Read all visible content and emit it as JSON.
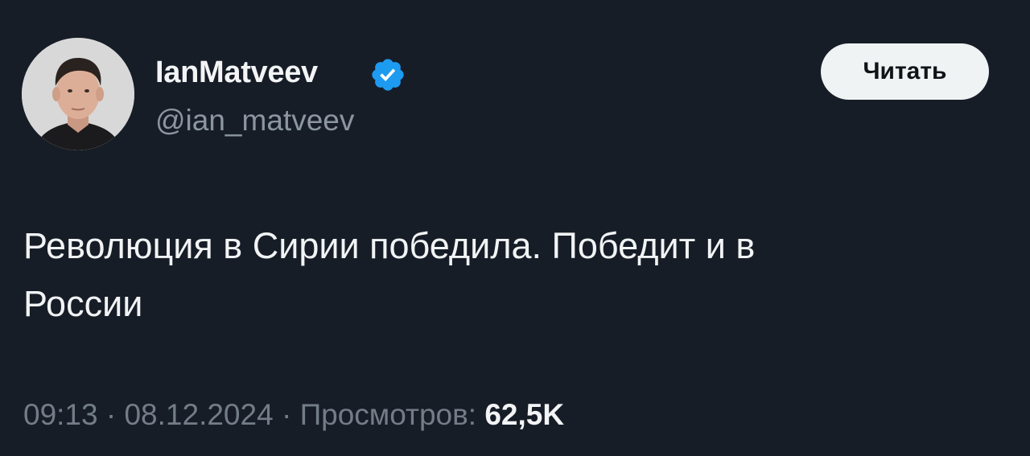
{
  "author": {
    "display_name": "IanMatveev",
    "handle": "@ian_matveev",
    "verified": true
  },
  "follow_button": {
    "label": "Читать"
  },
  "tweet": {
    "text": "Революция в Сирии победила. Победит и в\nРоссии"
  },
  "meta": {
    "time": "09:13",
    "separator": " · ",
    "date": "08.12.2024",
    "views_label": "Просмотров:",
    "views_count": "62,5K"
  },
  "colors": {
    "background": "#171d27",
    "verified_badge": "#1d9bf0",
    "button_bg": "#eff3f4",
    "muted_text": "#737d88"
  },
  "icons": {
    "verified": "verified-badge-icon",
    "avatar": "profile-photo"
  }
}
